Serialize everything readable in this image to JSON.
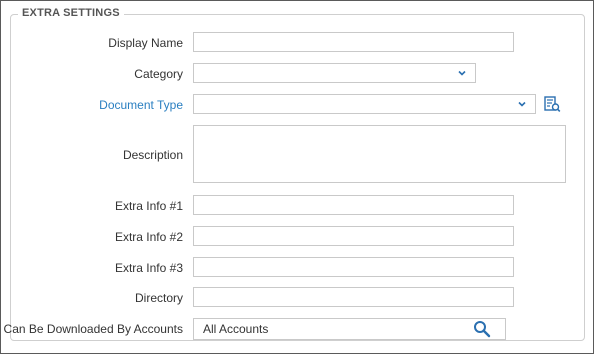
{
  "section": {
    "legend": "EXTRA SETTINGS"
  },
  "fields": {
    "display_name": {
      "label": "Display Name",
      "value": ""
    },
    "category": {
      "label": "Category",
      "value": ""
    },
    "document_type": {
      "label": "Document Type",
      "value": ""
    },
    "description": {
      "label": "Description",
      "value": ""
    },
    "extra_info_1": {
      "label": "Extra Info #1",
      "value": ""
    },
    "extra_info_2": {
      "label": "Extra Info #2",
      "value": ""
    },
    "extra_info_3": {
      "label": "Extra Info #3",
      "value": ""
    },
    "directory": {
      "label": "Directory",
      "value": ""
    },
    "downloadable_by": {
      "label": "Can Be Downloaded By Accounts",
      "value": "All Accounts"
    }
  },
  "icons": {
    "dropdown": "chevron-down-icon",
    "document_lookup": "document-search-icon",
    "search": "search-icon"
  },
  "colors": {
    "link": "#2a7fc1",
    "icon": "#2a6fb0"
  }
}
